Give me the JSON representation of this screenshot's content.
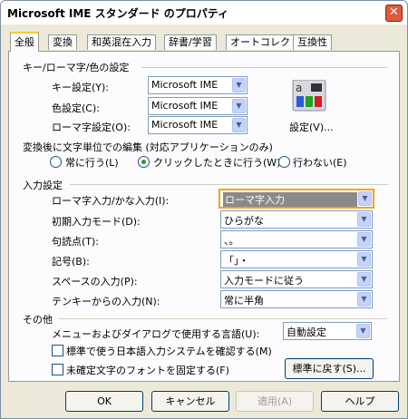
{
  "title": "Microsoft IME スタンダード のプロパティ",
  "tabs": [
    "全般",
    "変換",
    "和英混在入力",
    "辞書/学習",
    "オートコレクト",
    "互換性"
  ],
  "key_group": {
    "title": "キー/ローマ字/色の設定",
    "key_label": "キー設定(Y):",
    "key_value": "Microsoft IME",
    "color_label": "色設定(C):",
    "color_value": "Microsoft IME",
    "romaji_label": "ローマ字設定(O):",
    "romaji_value": "Microsoft IME",
    "settings_button": "設定(V)..."
  },
  "edit_group": {
    "title": "変換後に文字単位での編集 (対応アプリケーションのみ)",
    "options": [
      "常に行う(L)",
      "クリックしたときに行う(W)",
      "行わない(E)"
    ],
    "selected": 1
  },
  "input_group": {
    "title": "入力設定",
    "rows": [
      {
        "label": "ローマ字入力/かな入力(I):",
        "value": "ローマ字入力"
      },
      {
        "label": "初期入力モード(D):",
        "value": "ひらがな"
      },
      {
        "label": "句読点(T):",
        "value": "、。"
      },
      {
        "label": "記号(B):",
        "value": "「」・"
      },
      {
        "label": "スペースの入力(P):",
        "value": "入力モードに従う"
      },
      {
        "label": "テンキーからの入力(N):",
        "value": "常に半角"
      }
    ]
  },
  "other_group": {
    "title": "その他",
    "language_label": "メニューおよびダイアログで使用する言語(U):",
    "language_value": "自動設定",
    "check1": "標準で使う日本語入力システムを確認する(M)",
    "check2": "未確定文字のフォントを固定する(F)",
    "reset_button": "標準に戻す(S)..."
  },
  "footer": {
    "ok": "OK",
    "cancel": "キャンセル",
    "apply": "適用(A)",
    "help": "ヘルプ"
  }
}
